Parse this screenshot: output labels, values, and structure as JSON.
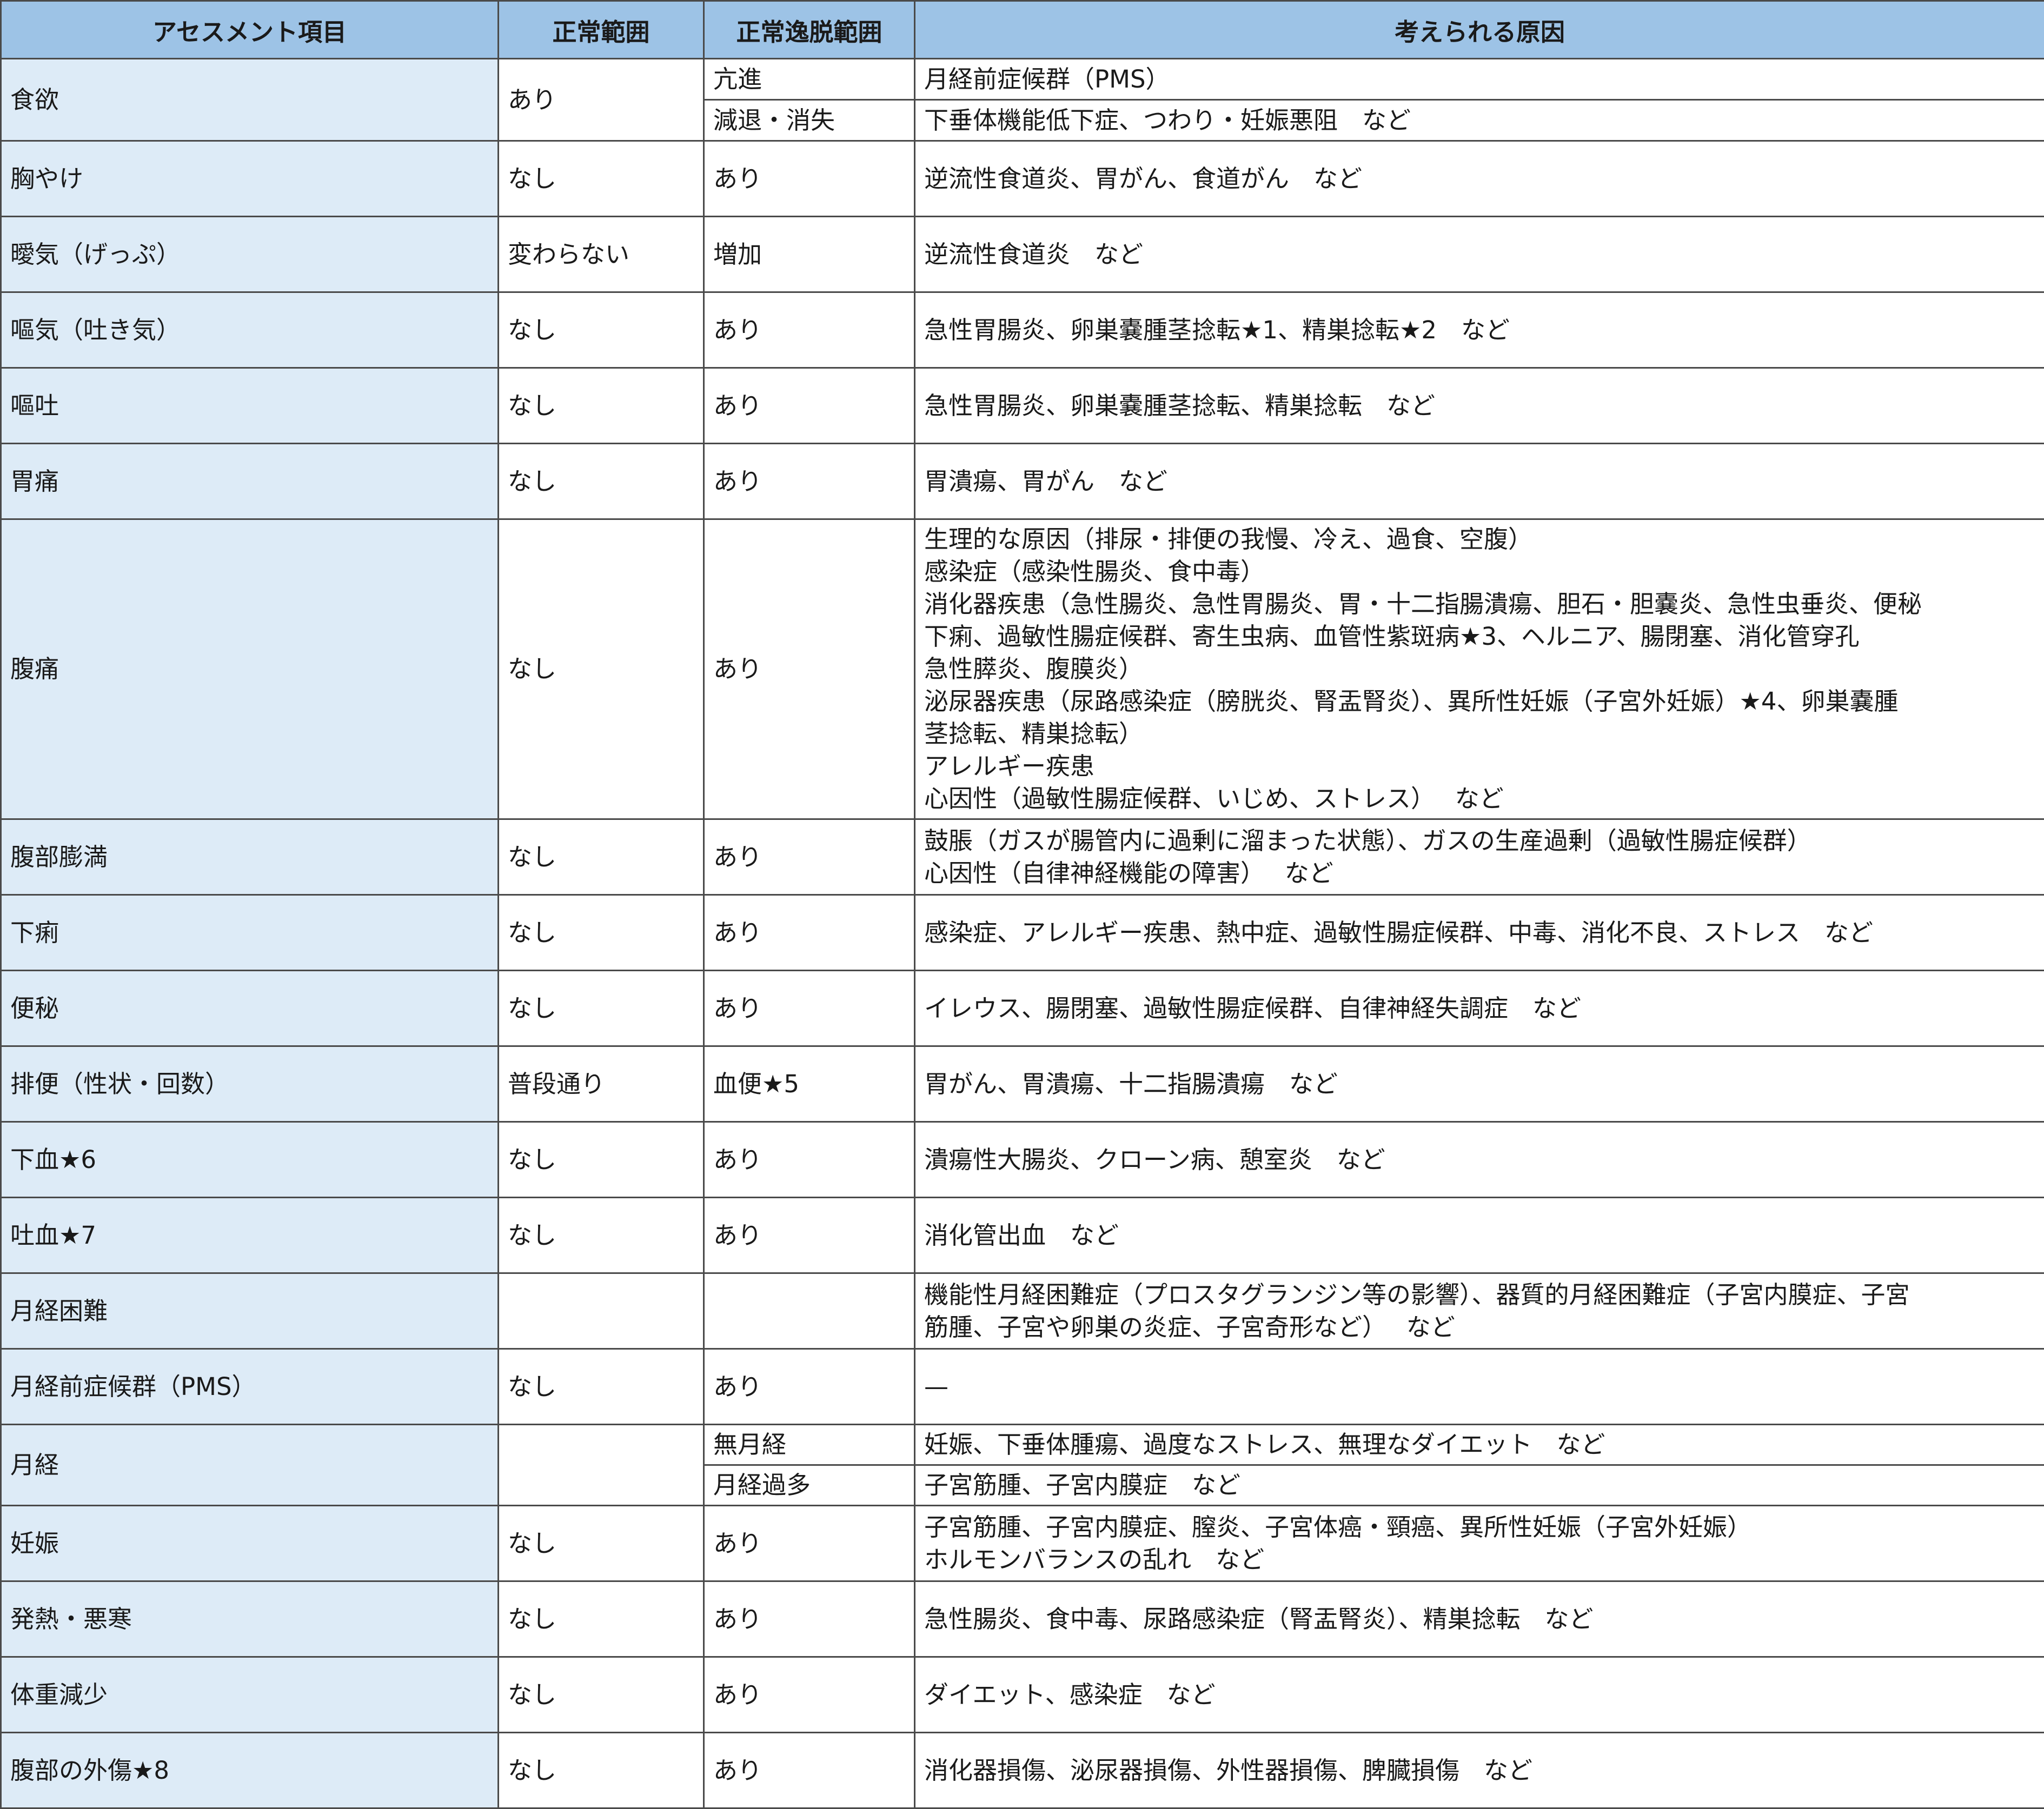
{
  "headers": [
    "アセスメント項目",
    "正常範囲",
    "正常逸脱範囲",
    "考えられる原因"
  ],
  "rows": [
    {
      "item": "食欲",
      "normal": "あり",
      "sub": [
        {
          "abnormal": "亢進",
          "cause": "月経前症候群（PMS）"
        },
        {
          "abnormal": "減退・消失",
          "cause": "下垂体機能低下症、つわり・妊娠悪阻　など"
        }
      ]
    },
    {
      "item": "胸やけ",
      "normal": "なし",
      "abnormal": "あり",
      "cause": "逆流性食道炎、胃がん、食道がん　など"
    },
    {
      "item": "曖気（げっぷ）",
      "normal": "変わらない",
      "abnormal": "増加",
      "cause": "逆流性食道炎　など"
    },
    {
      "item": "嘔気（吐き気）",
      "normal": "なし",
      "abnormal": "あり",
      "cause": "急性胃腸炎、卵巣嚢腫茎捻転★1、精巣捻転★2　など"
    },
    {
      "item": "嘔吐",
      "normal": "なし",
      "abnormal": "あり",
      "cause": "急性胃腸炎、卵巣嚢腫茎捻転、精巣捻転　など"
    },
    {
      "item": "胃痛",
      "normal": "なし",
      "abnormal": "あり",
      "cause": "胃潰瘍、胃がん　など"
    },
    {
      "item": "腹痛",
      "normal": "なし",
      "abnormal": "あり",
      "cause_lines": [
        "生理的な原因（排尿・排便の我慢、冷え、過食、空腹）",
        "感染症（感染性腸炎、食中毒）",
        "消化器疾患（急性腸炎、急性胃腸炎、胃・十二指腸潰瘍、胆石・胆嚢炎、急性虫垂炎、便秘",
        "下痢、過敏性腸症候群、寄生虫病、血管性紫斑病★3、ヘルニア、腸閉塞、消化管穿孔",
        "急性膵炎、腹膜炎）",
        "泌尿器疾患（尿路感染症（膀胱炎、腎盂腎炎）、異所性妊娠（子宮外妊娠）★4、卵巣嚢腫",
        "茎捻転、精巣捻転）",
        "アレルギー疾患",
        "心因性（過敏性腸症候群、いじめ、ストレス）　 など"
      ]
    },
    {
      "item": "腹部膨満",
      "normal": "なし",
      "abnormal": "あり",
      "cause_lines": [
        "鼓脹（ガスが腸管内に過剰に溜まった状態）、ガスの生産過剰（過敏性腸症候群）",
        "心因性（自律神経機能の障害）　 など"
      ]
    },
    {
      "item": "下痢",
      "normal": "なし",
      "abnormal": "あり",
      "cause": "感染症、アレルギー疾患、熱中症、過敏性腸症候群、中毒、消化不良、ストレス　など"
    },
    {
      "item": "便秘",
      "normal": "なし",
      "abnormal": "あり",
      "cause": "イレウス、腸閉塞、過敏性腸症候群、自律神経失調症　など"
    },
    {
      "item": "排便（性状・回数）",
      "normal": "普段通り",
      "abnormal": "血便★5",
      "cause": "胃がん、胃潰瘍、十二指腸潰瘍　など"
    },
    {
      "item": "下血★6",
      "normal": "なし",
      "abnormal": "あり",
      "cause": "潰瘍性大腸炎、クローン病、憩室炎　など"
    },
    {
      "item": "吐血★7",
      "normal": "なし",
      "abnormal": "あり",
      "cause": "消化管出血　など"
    },
    {
      "item": "月経困難",
      "normal": "",
      "abnormal": "",
      "cause_lines": [
        "機能性月経困難症（プロスタグランジン等の影響）、器質的月経困難症（子宮内膜症、子宮",
        "筋腫、子宮や卵巣の炎症、子宮奇形など）　 など"
      ]
    },
    {
      "item": "月経前症候群（PMS）",
      "normal": "なし",
      "abnormal": "あり",
      "cause": "—"
    },
    {
      "item": "月経",
      "normal": "",
      "sub": [
        {
          "abnormal": "無月経",
          "cause": "妊娠、下垂体腫瘍、過度なストレス、無理なダイエット　など"
        },
        {
          "abnormal": "月経過多",
          "cause": "子宮筋腫、子宮内膜症　など"
        }
      ]
    },
    {
      "item": "妊娠",
      "normal": "なし",
      "abnormal": "あり",
      "cause_lines": [
        "子宮筋腫、子宮内膜症、膣炎、子宮体癌・頸癌、異所性妊娠（子宮外妊娠）",
        "ホルモンバランスの乱れ　など"
      ]
    },
    {
      "item": "発熱・悪寒",
      "normal": "なし",
      "abnormal": "あり",
      "cause": "急性腸炎、食中毒、尿路感染症（腎盂腎炎）、精巣捻転　など"
    },
    {
      "item": "体重減少",
      "normal": "なし",
      "abnormal": "あり",
      "cause": "ダイエット、感染症　など"
    },
    {
      "item": "腹部の外傷★8",
      "normal": "なし",
      "abnormal": "あり",
      "cause": "消化器損傷、泌尿器損傷、外性器損傷、脾臓損傷　など"
    }
  ]
}
